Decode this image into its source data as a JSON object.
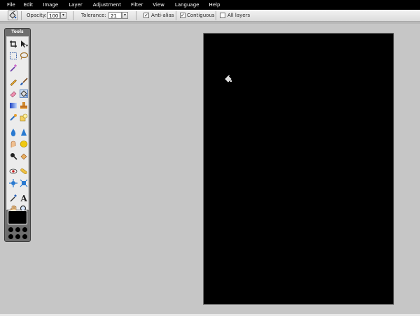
{
  "menu": {
    "items": [
      "File",
      "Edit",
      "Image",
      "Layer",
      "Adjustment",
      "Filter",
      "View",
      "Language",
      "Help"
    ]
  },
  "options": {
    "tool_icon": "paint-bucket-icon",
    "opacity_label": "Opacity:",
    "opacity_value": "100",
    "tolerance_label": "Tolerance:",
    "tolerance_value": "21",
    "antialias_label": "Anti-alias",
    "antialias_checked": true,
    "contiguous_label": "Contiguous",
    "contiguous_checked": true,
    "all_layers_label": "All layers",
    "all_layers_checked": false
  },
  "tools": {
    "title": "Tools",
    "items": [
      "crop-icon",
      "move-icon",
      "marquee-icon",
      "lasso-icon",
      "magic-wand-icon",
      "",
      "pencil-icon",
      "brush-icon",
      "eraser-icon",
      "paint-bucket-icon",
      "gradient-icon",
      "clone-stamp-icon",
      "color-replace-icon",
      "drawing-icon",
      "blur-icon",
      "sharpen-icon",
      "smudge-icon",
      "sponge-icon",
      "dodge-icon",
      "burn-icon",
      "red-eye-icon",
      "spot-heal-icon",
      "bloat-icon",
      "pinch-icon",
      "color-picker-icon",
      "type-icon",
      "hand-icon",
      "zoom-icon"
    ],
    "selected": "paint-bucket-icon",
    "foreground_color": "#000000"
  },
  "canvas": {
    "background": "#000000"
  },
  "colors": {
    "menu_bg": "#000000",
    "workspace_bg": "#c6c6c6",
    "selected_tool": "#c7d8ef"
  }
}
